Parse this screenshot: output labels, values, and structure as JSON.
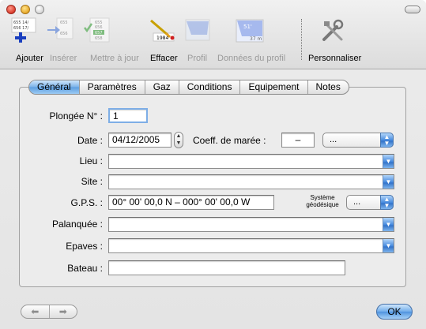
{
  "toolbar": {
    "items": [
      {
        "label": "Ajouter",
        "enabled": true,
        "icon": "add-dive-icon"
      },
      {
        "label": "Insérer",
        "enabled": false,
        "icon": "insert-dive-icon"
      },
      {
        "label": "Mettre à jour",
        "enabled": false,
        "icon": "update-icon"
      },
      {
        "label": "Effacer",
        "enabled": true,
        "icon": "erase-icon"
      },
      {
        "label": "Profil",
        "enabled": false,
        "icon": "profile-icon"
      },
      {
        "label": "Données du profil",
        "enabled": false,
        "icon": "profile-data-icon"
      },
      {
        "label": "Personnaliser",
        "enabled": true,
        "icon": "customize-icon"
      }
    ],
    "icon_text": {
      "ajouter_lines": [
        "655  14/",
        "656  17/"
      ],
      "inserer_lines": [
        "655",
        "656"
      ],
      "maj_lines": [
        "655",
        "656",
        "657",
        "658"
      ],
      "effacer_year": "1984",
      "donnees_top": "51'",
      "donnees_bottom": "37 m"
    }
  },
  "tabs": [
    "Général",
    "Paramètres",
    "Gaz",
    "Conditions",
    "Equipement",
    "Notes"
  ],
  "active_tab": "Général",
  "form": {
    "plongee_label": "Plongée N° :",
    "plongee_value": "1",
    "date_label": "Date :",
    "date_value": "04/12/2005",
    "coeff_label": "Coeff. de marée :",
    "coeff_value": "–",
    "coeff_popup": "...",
    "lieu_label": "Lieu :",
    "lieu_value": "",
    "site_label": "Site :",
    "site_value": "",
    "gps_label": "G.P.S. :",
    "gps_value": "00° 00' 00,0 N – 000° 00' 00,0 W",
    "systeme_label_1": "Système",
    "systeme_label_2": "géodésique",
    "systeme_popup": "...",
    "palanquee_label": "Palanquée :",
    "palanquee_value": "",
    "epaves_label": "Epaves :",
    "epaves_value": "",
    "bateau_label": "Bateau :",
    "bateau_value": ""
  },
  "footer": {
    "prev_glyph": "⬅",
    "next_glyph": "➡",
    "ok_label": "OK"
  },
  "colors": {
    "accent_blue": "#4e93df",
    "disabled_text": "#9a9a9a"
  }
}
